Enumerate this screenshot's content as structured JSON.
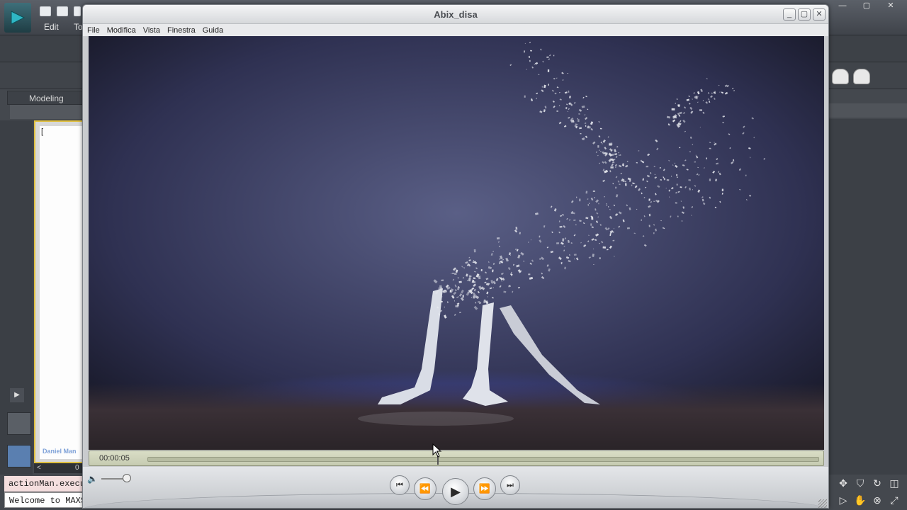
{
  "background_app": {
    "menus": [
      "Edit",
      "To"
    ],
    "ribbon_tab": "Modeling",
    "viewport_label": "[",
    "watermark": "Daniel Man",
    "scroll_value": "0",
    "listener_line1": "actionMan.execu",
    "listener_line2": "Welcome to MAXS",
    "window_controls": [
      "—",
      "▢",
      "✕"
    ]
  },
  "player": {
    "title": "Abix_disa",
    "window_controls": [
      "_",
      "▢",
      "✕"
    ],
    "menu": [
      "File",
      "Modifica",
      "Vista",
      "Finestra",
      "Guida"
    ],
    "time": "00:00:05",
    "playhead_fraction": 0.43,
    "volume_fraction": 0.9,
    "transport": {
      "start": "⏮",
      "rewind": "⏪",
      "play": "▶",
      "forward": "⏩",
      "end": "⏭"
    }
  },
  "icons": {
    "volume": "speaker-icon",
    "resize": "resize-grip-icon"
  }
}
